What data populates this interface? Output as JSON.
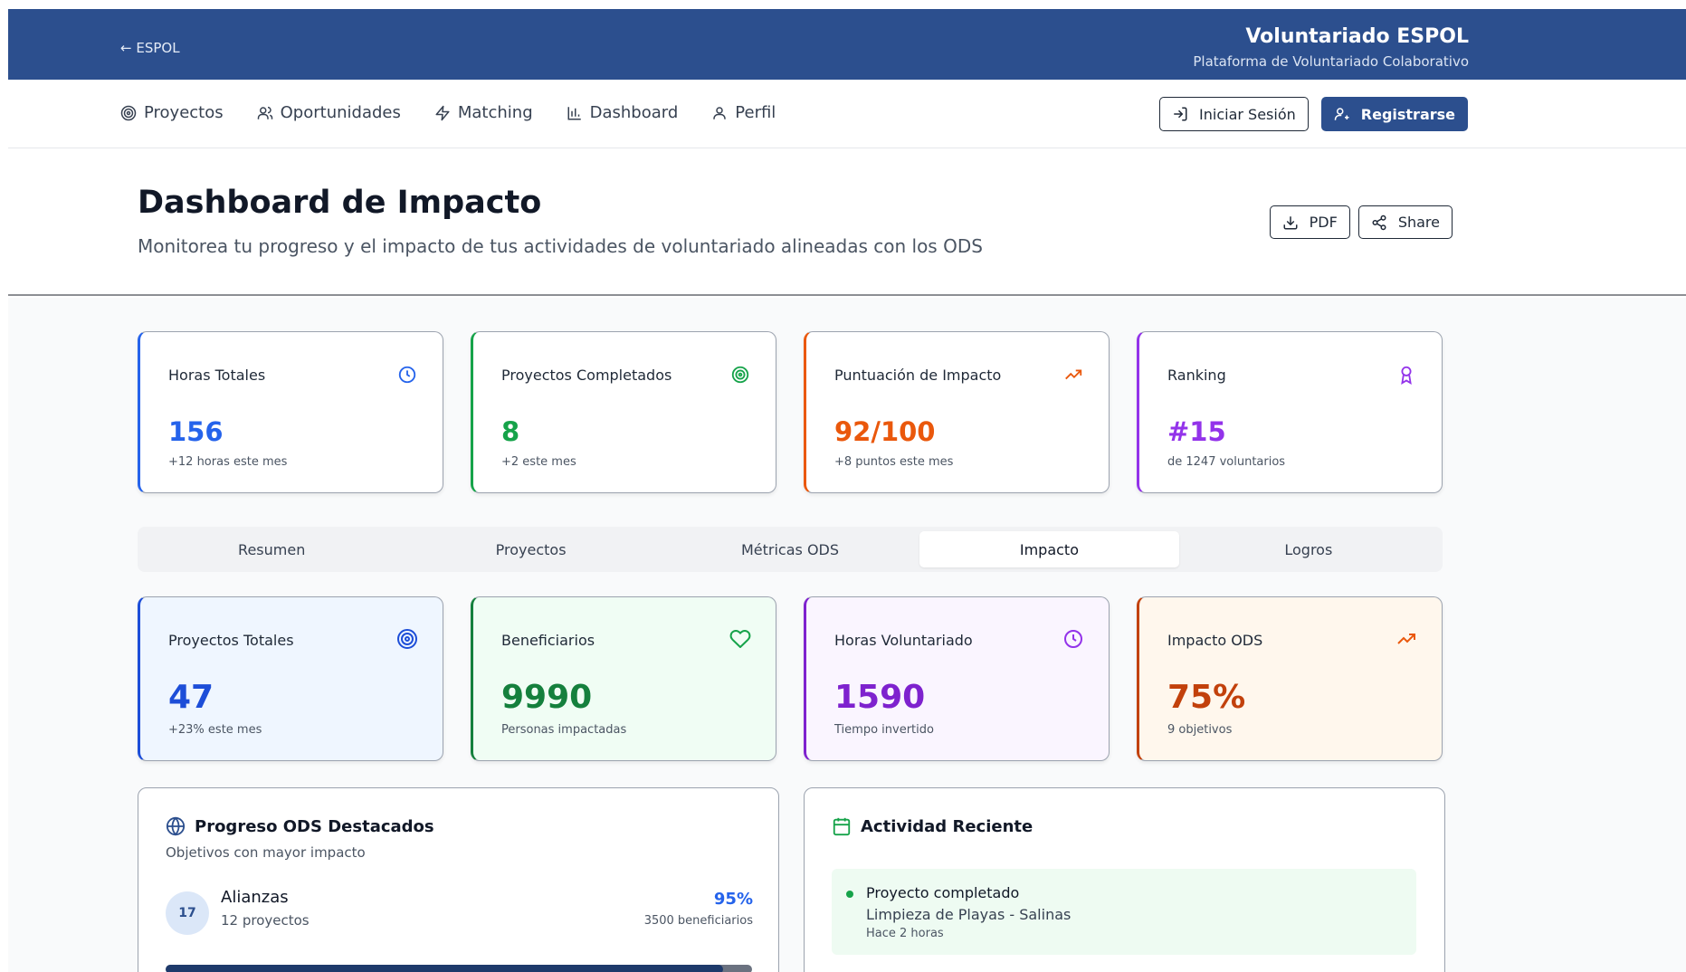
{
  "topbar": {
    "back_label": "← ESPOL",
    "title": "Voluntariado ESPOL",
    "subtitle": "Plataforma de Voluntariado Colaborativo"
  },
  "nav": {
    "items": [
      {
        "label": "Proyectos",
        "icon": "target-icon"
      },
      {
        "label": "Oportunidades",
        "icon": "users-icon"
      },
      {
        "label": "Matching",
        "icon": "lightning-icon"
      },
      {
        "label": "Dashboard",
        "icon": "bar-chart-icon"
      },
      {
        "label": "Perfil",
        "icon": "user-icon"
      }
    ],
    "login_label": "Iniciar Sesión",
    "register_label": "Registrarse"
  },
  "header": {
    "title": "Dashboard de Impacto",
    "subtitle": "Monitorea tu progreso y el impacto de tus actividades de voluntariado alineadas con los ODS",
    "pdf_label": "PDF",
    "share_label": "Share"
  },
  "stats": [
    {
      "label": "Horas Totales",
      "value": "156",
      "note": "+12 horas este mes",
      "color": "#2563eb",
      "icon": "clock-icon"
    },
    {
      "label": "Proyectos Completados",
      "value": "8",
      "note": "+2 este mes",
      "color": "#16a34a",
      "icon": "target-icon"
    },
    {
      "label": "Puntuación de Impacto",
      "value": "92/100",
      "note": "+8 puntos este mes",
      "color": "#ea580c",
      "icon": "trending-up-icon"
    },
    {
      "label": "Ranking",
      "value": "#15",
      "note": "de 1247 voluntarios",
      "color": "#9333ea",
      "icon": "award-icon"
    }
  ],
  "tabs": [
    {
      "label": "Resumen",
      "active": false
    },
    {
      "label": "Proyectos",
      "active": false
    },
    {
      "label": "Métricas ODS",
      "active": false
    },
    {
      "label": "Impacto",
      "active": true
    },
    {
      "label": "Logros",
      "active": false
    }
  ],
  "impact_cards": [
    {
      "label": "Proyectos Totales",
      "value": "47",
      "note": "+23% este mes",
      "color": "#1d4ed8",
      "bg": "#eff6ff",
      "icon": "target-icon"
    },
    {
      "label": "Beneficiarios",
      "value": "9990",
      "note": "Personas impactadas",
      "color": "#15803d",
      "bg": "#f0fdf4",
      "icon": "heart-icon"
    },
    {
      "label": "Horas Voluntariado",
      "value": "1590",
      "note": "Tiempo invertido",
      "color": "#7e22ce",
      "bg": "#faf5ff",
      "icon": "clock-icon"
    },
    {
      "label": "Impacto ODS",
      "value": "75%",
      "note": "9 objetivos",
      "color": "#c2410c",
      "bg": "#fff7ed",
      "icon": "trending-up-icon"
    }
  ],
  "ods_panel": {
    "title": "Progreso ODS Destacados",
    "subtitle": "Objetivos con mayor impacto",
    "items": [
      {
        "number": "17",
        "name": "Alianzas",
        "projects": "12 proyectos",
        "percent": "95%",
        "beneficiaries": "3500 beneficiarios",
        "progress": 0.95
      }
    ]
  },
  "activity_panel": {
    "title": "Actividad Reciente",
    "items": [
      {
        "type": "Proyecto completado",
        "detail": "Limpieza de Playas - Salinas",
        "time": "Hace 2 horas"
      }
    ]
  }
}
